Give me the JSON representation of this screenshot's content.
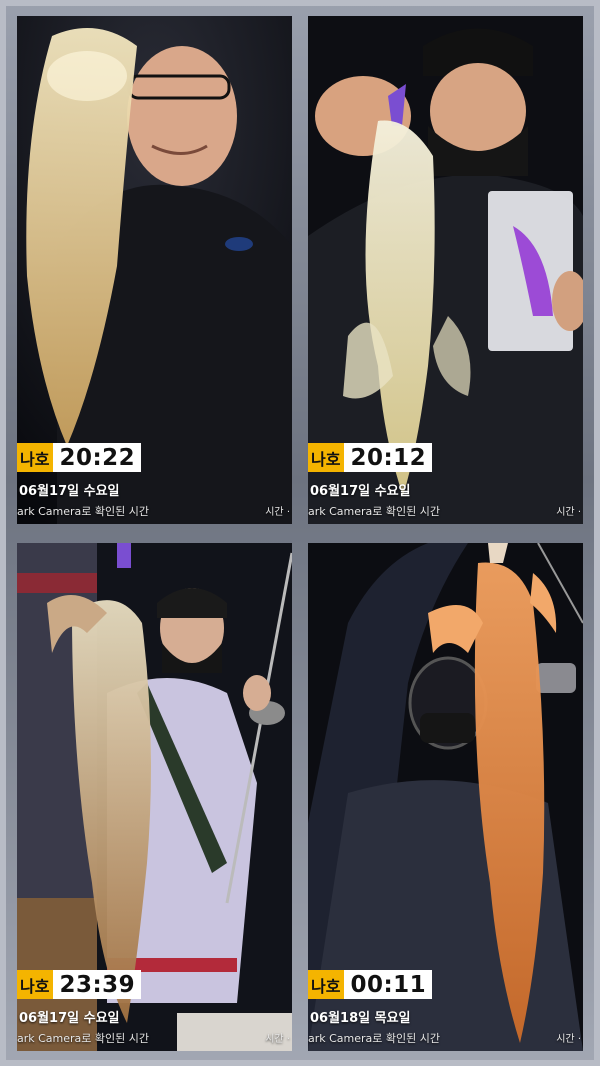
{
  "photos": [
    {
      "tag": "나호",
      "time": "20:22",
      "date": "06월17일 수요일",
      "verify": "ark Camera로 확인된 시간",
      "right": "시간 ·"
    },
    {
      "tag": "나호",
      "time": "20:12",
      "date": "06월17일 수요일",
      "verify": "ark Camera로 확인된 시간",
      "right": "시간 ·"
    },
    {
      "tag": "나호",
      "time": "23:39",
      "date": "06월17일 수요일",
      "verify": "ark Camera로 확인된 시간",
      "right": "시간 ·"
    },
    {
      "tag": "나호",
      "time": "00:11",
      "date": "06월18일 목요일",
      "verify": "ark Camera로 확인된 시간",
      "right": "시간 ·"
    }
  ]
}
